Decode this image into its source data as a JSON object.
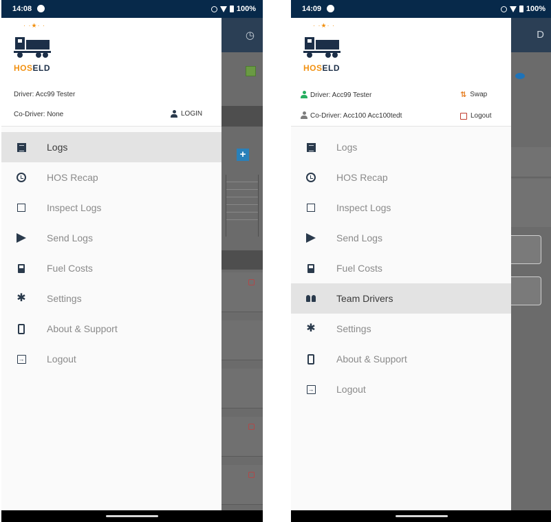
{
  "colors": {
    "status_bar": "#07294a",
    "brand_orange": "#f29111",
    "brand_navy": "#1c2f48",
    "active_item": "#e3e3e3",
    "swap_orange": "#e67e22",
    "logout_red": "#c0392b",
    "driver_green": "#27ae60"
  },
  "left": {
    "status": {
      "time": "14:08",
      "battery": "100%"
    },
    "brand": {
      "hos": "HOS",
      "eld": "ELD"
    },
    "driver_label": "Driver: Acc99 Tester",
    "codriver_label": "Co-Driver: None",
    "login_label": "LOGIN",
    "menu": [
      {
        "label": "Logs",
        "icon": "logs-icon"
      },
      {
        "label": "HOS Recap",
        "icon": "alarm-clock-icon"
      },
      {
        "label": "Inspect Logs",
        "icon": "inspect-icon"
      },
      {
        "label": "Send Logs",
        "icon": "send-icon"
      },
      {
        "label": "Fuel Costs",
        "icon": "fuel-icon"
      },
      {
        "label": "Settings",
        "icon": "gear-icon"
      },
      {
        "label": "About & Support",
        "icon": "phone-icon"
      },
      {
        "label": "Logout",
        "icon": "logout-icon"
      }
    ],
    "active_index": 0
  },
  "right": {
    "status": {
      "time": "14:09",
      "battery": "100%"
    },
    "brand": {
      "hos": "HOS",
      "eld": "ELD"
    },
    "driver_label": "Driver: Acc99 Tester",
    "codriver_label": "Co-Driver: Acc100 Acc100tedt",
    "swap_label": "Swap",
    "logout_label": "Logout",
    "menu": [
      {
        "label": "Logs",
        "icon": "logs-icon"
      },
      {
        "label": "HOS Recap",
        "icon": "alarm-clock-icon"
      },
      {
        "label": "Inspect Logs",
        "icon": "inspect-icon"
      },
      {
        "label": "Send Logs",
        "icon": "send-icon"
      },
      {
        "label": "Fuel Costs",
        "icon": "fuel-icon"
      },
      {
        "label": "Team Drivers",
        "icon": "team-icon"
      },
      {
        "label": "Settings",
        "icon": "gear-icon"
      },
      {
        "label": "About & Support",
        "icon": "phone-icon"
      },
      {
        "label": "Logout",
        "icon": "logout-icon"
      }
    ],
    "active_index": 5
  }
}
